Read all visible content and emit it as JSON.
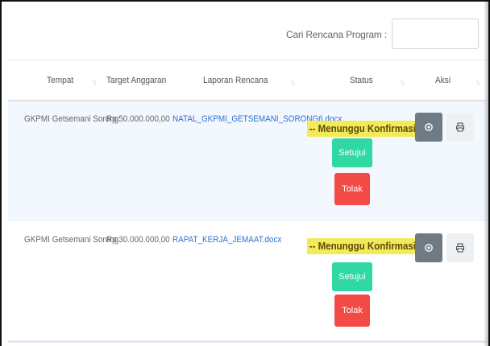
{
  "search": {
    "label": "Cari Rencana Program :",
    "placeholder": "",
    "value": ""
  },
  "table": {
    "headers": [
      {
        "label": "Tempat",
        "sort_icon": "sort-icon"
      },
      {
        "label": "Target Anggaran",
        "sort_icon": "sort-icon"
      },
      {
        "label": "Laporan Rencana",
        "sort_icon": "sort-icon"
      },
      {
        "label": "Status",
        "sort_icon": "sort-icon"
      },
      {
        "label": "Aksi",
        "sort_icon": "sort-icon"
      }
    ],
    "sort_glyph": "↑↓",
    "rows": [
      {
        "tempat": "GKPMI Getsemani Sorong",
        "target_anggaran": "Rp 50.000.000,00",
        "laporan_rencana": "NATAL_GKPMI_GETSEMANI_SORONG6.docx",
        "status": "-- Menunggu Konfirmasi--",
        "approve_label": "Setujui",
        "reject_label": "Tolak",
        "view_icon": "eye-icon",
        "print_icon": "printer-icon"
      },
      {
        "tempat": "GKPMI Getsemani Sorong",
        "target_anggaran": "Rp 30.000.000,00",
        "laporan_rencana": "RAPAT_KERJA_JEMAAT.docx",
        "status": "-- Menunggu Konfirmasi--",
        "approve_label": "Setujui",
        "reject_label": "Tolak",
        "view_icon": "eye-icon",
        "print_icon": "printer-icon"
      }
    ]
  },
  "colors": {
    "status_highlight": "#f3ea5a",
    "approve": "#30d9a4",
    "reject": "#f24a45",
    "view": "#6e7b85",
    "print": "#eef1f3",
    "link": "#2f6fd6",
    "row_highlight": "#f2f8fd"
  }
}
